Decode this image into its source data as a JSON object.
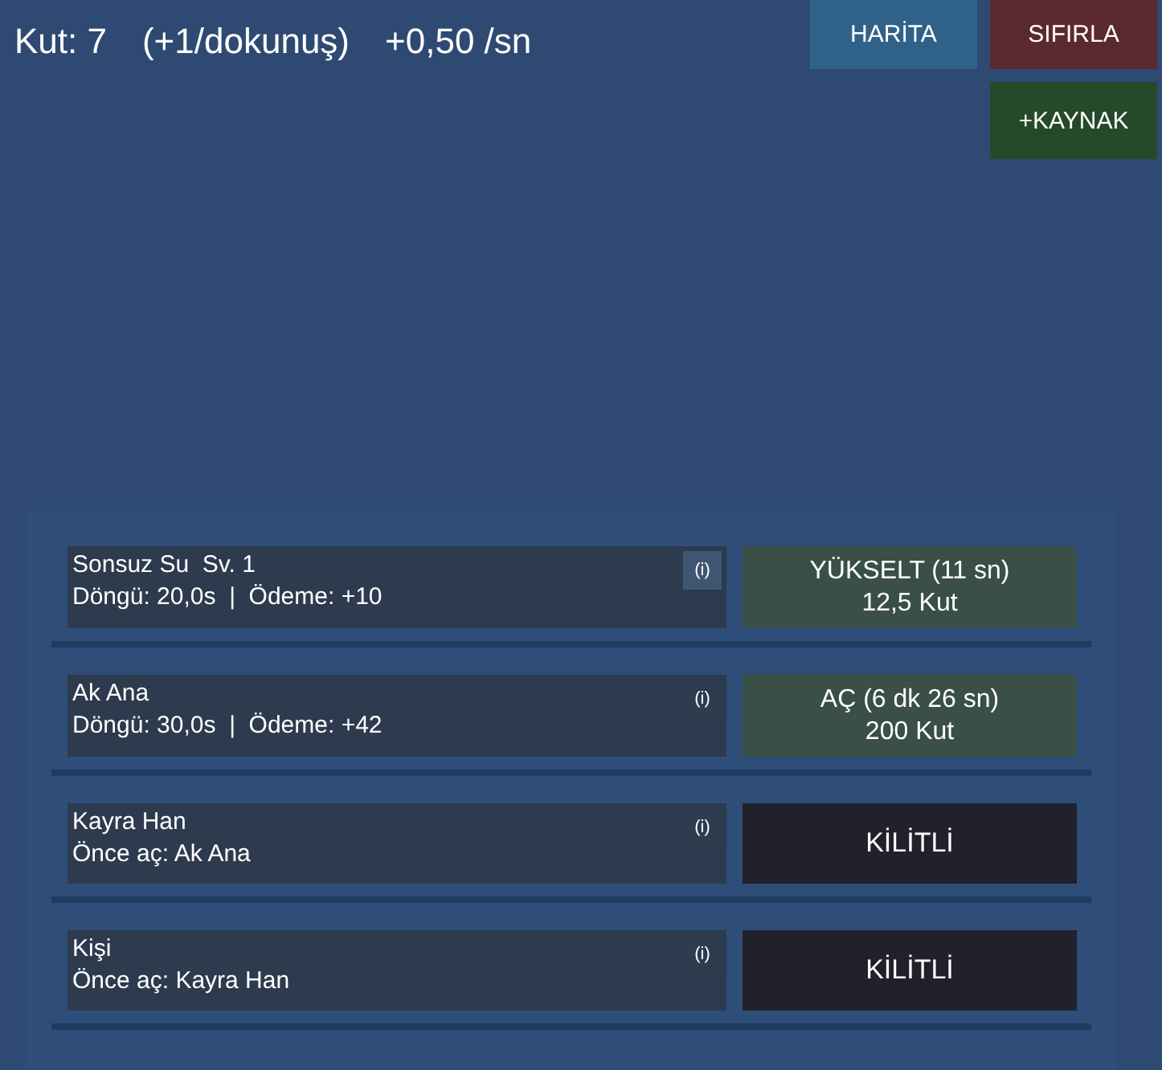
{
  "header": {
    "stats": [
      "Kut: 7",
      "(+1/dokunuş)",
      "+0,50 /sn"
    ],
    "buttons": [
      {
        "label": "HARİTA",
        "kind": "map"
      },
      {
        "label": "SIFIRLA",
        "kind": "reset"
      },
      {
        "label": "+KAYNAK",
        "kind": "add"
      }
    ]
  },
  "producers": [
    {
      "name": "Sonsuz Su  Sv. 1",
      "detail": "Döngü: 20,0s  |  Ödeme: +10",
      "info": "(i)",
      "info_active": true,
      "kind": "action",
      "action": [
        "YÜKSELT (11 sn)",
        "12,5 Kut"
      ]
    },
    {
      "name": "Ak Ana",
      "detail": "Döngü: 30,0s  |  Ödeme: +42",
      "info": "(i)",
      "info_active": false,
      "kind": "action",
      "action": [
        "AÇ (6 dk 26 sn)",
        "200 Kut"
      ]
    },
    {
      "name": "Kayra Han",
      "detail": "Önce aç: Ak Ana",
      "info": "(i)",
      "info_active": false,
      "kind": "locked",
      "action": [
        "KİLİTLİ"
      ]
    },
    {
      "name": "Kişi",
      "detail": "Önce aç: Kayra Han",
      "info": "(i)",
      "info_active": false,
      "kind": "locked",
      "action": [
        "KİLİTLİ"
      ]
    }
  ]
}
